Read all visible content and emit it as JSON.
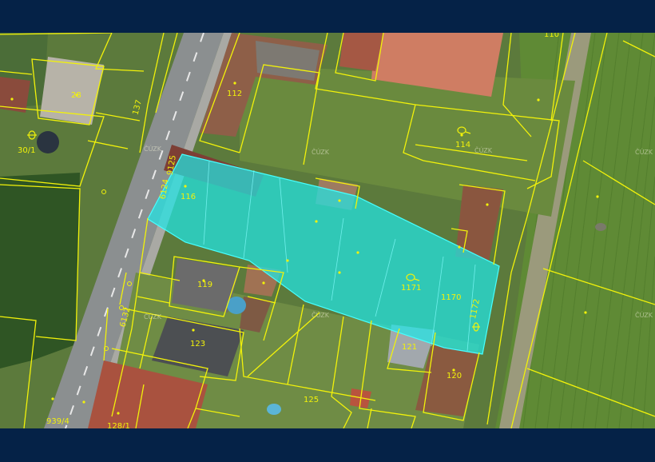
{
  "map": {
    "colors": {
      "frame": "#052247",
      "parcel_line": "#f2f20a",
      "highlight_fill": "#20e6e6",
      "highlight_stroke": "#46ffff",
      "road": "#8b8f90",
      "field": "#5f8a35"
    },
    "watermark": "ČÚZK",
    "parcel_labels": {
      "p28": "28",
      "p112": "112",
      "p114": "114",
      "p116": "116",
      "p119": "119",
      "p120": "120",
      "p121": "121",
      "p123": "123",
      "p125": "125",
      "p128_1": "128/1",
      "p30_1": "30/1",
      "p1171": "1171",
      "p1170": "1170",
      "p1172": "1172",
      "p110": "110",
      "p6124": "6124",
      "p9125": "9125",
      "p939_4": "939/4",
      "p137": "137",
      "p6132": "6132"
    }
  }
}
